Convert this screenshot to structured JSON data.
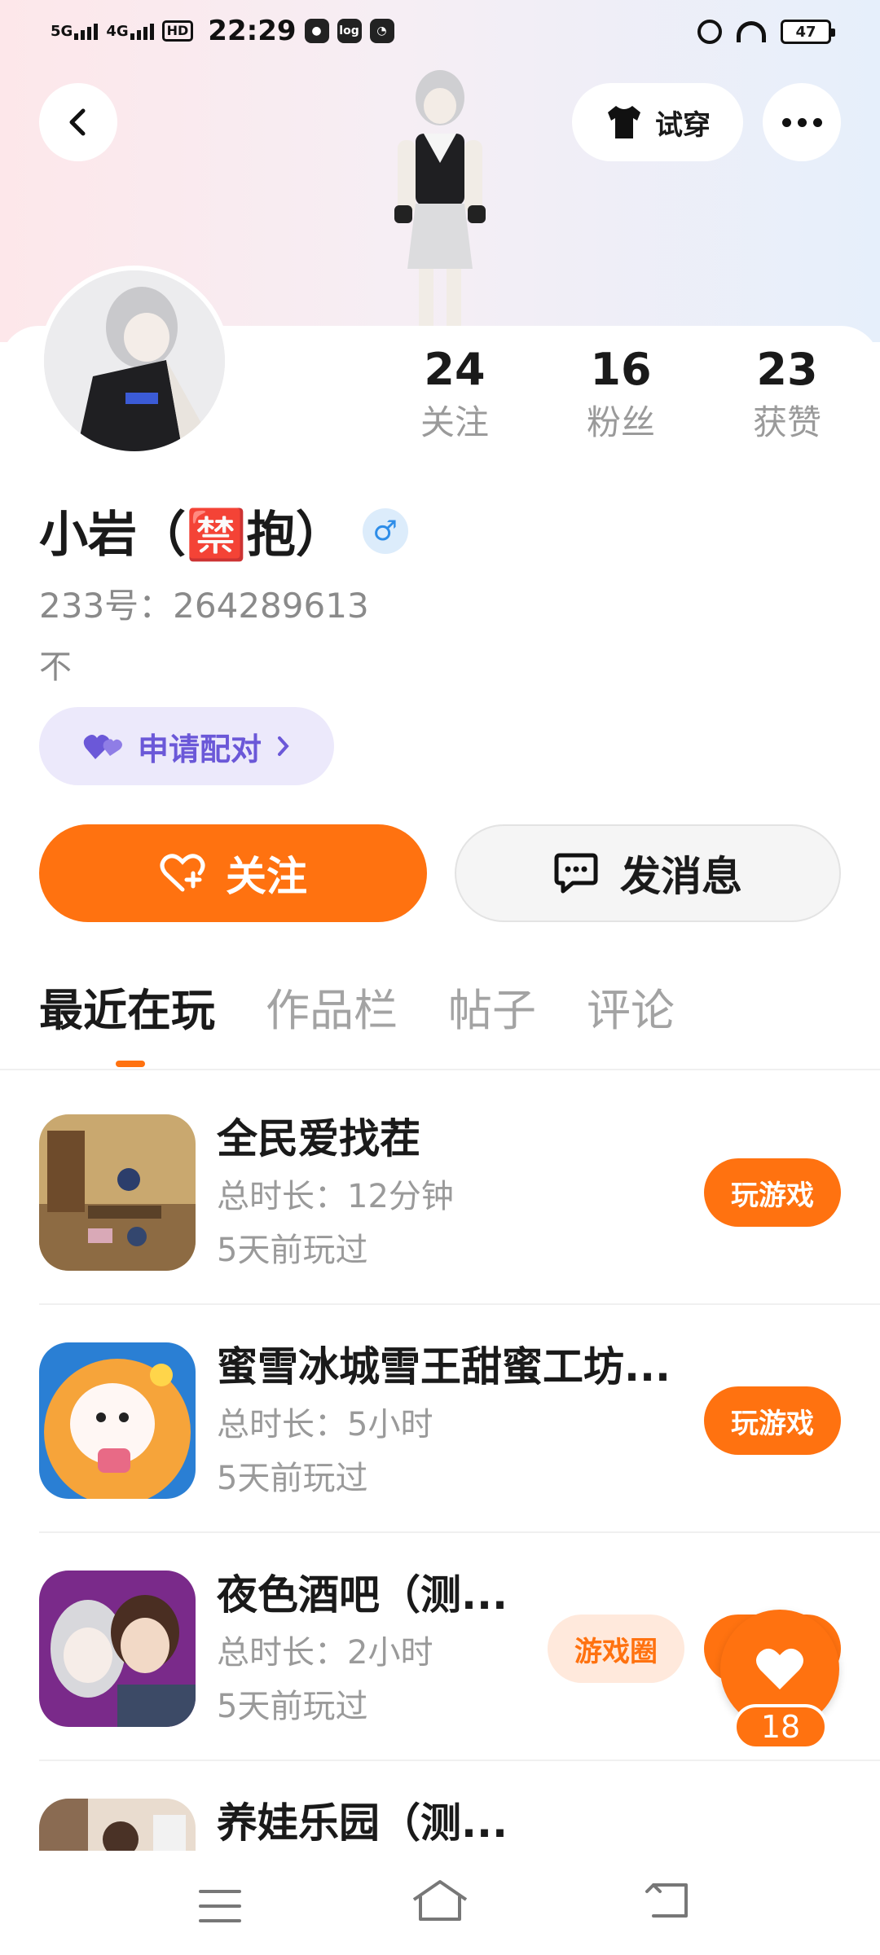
{
  "status_bar": {
    "signal1": "5G",
    "signal2": "4G",
    "hd": "HD",
    "time": "22:29",
    "app_icon": "log",
    "battery": "47"
  },
  "header": {
    "tryon_label": "试穿"
  },
  "stats": [
    {
      "value": "24",
      "label": "关注"
    },
    {
      "value": "16",
      "label": "粉丝"
    },
    {
      "value": "23",
      "label": "获赞"
    }
  ],
  "profile": {
    "name": "小岩（🈲抱）",
    "gender": "♂",
    "uid": "233号：264289613",
    "bio": "不",
    "pair_label": "申请配对"
  },
  "actions": {
    "follow": "关注",
    "message": "发消息"
  },
  "tabs": [
    "最近在玩",
    "作品栏",
    "帖子",
    "评论"
  ],
  "games": [
    {
      "title": "全民爱找茬",
      "duration": "总时长：12分钟",
      "last_played": "5天前玩过",
      "play": "玩游戏"
    },
    {
      "title": "蜜雪冰城雪王甜蜜工坊...",
      "duration": "总时长：5小时",
      "last_played": "5天前玩过",
      "play": "玩游戏"
    },
    {
      "title": "夜色酒吧（测...",
      "duration": "总时长：2小时",
      "last_played": "5天前玩过",
      "play": "玩游戏",
      "circle": "游戏圈"
    },
    {
      "title": "养娃乐园（测..."
    }
  ],
  "like": {
    "count": "18"
  },
  "colors": {
    "accent": "#ff7210",
    "pair": "#6b58d8",
    "pair_bg": "#ece9fb",
    "muted": "#9a9a9a"
  }
}
